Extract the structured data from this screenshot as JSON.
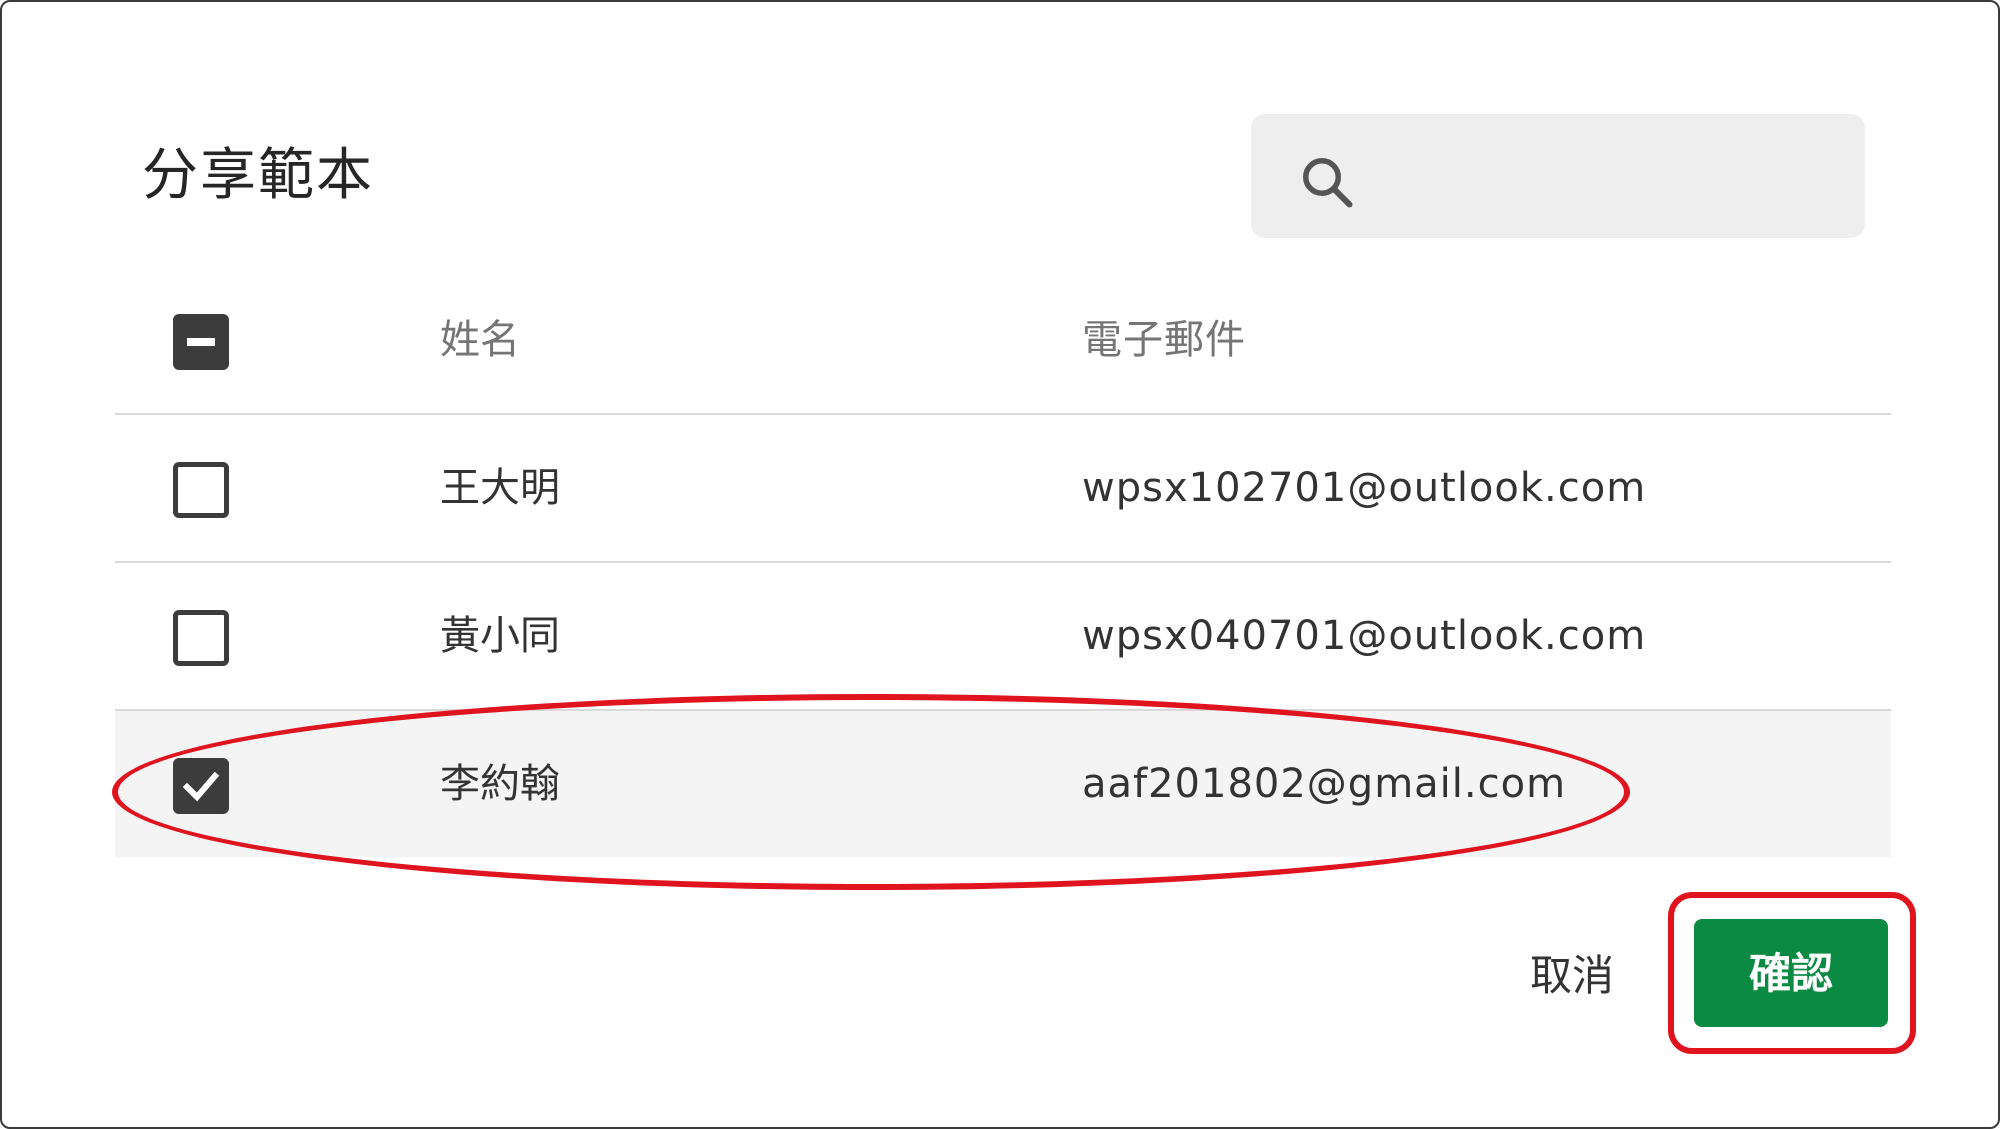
{
  "dialog": {
    "title": "分享範本",
    "search": {
      "value": "",
      "placeholder": "",
      "icon": "search-icon"
    }
  },
  "table": {
    "header": {
      "select_all_state": "indeterminate",
      "name": "姓名",
      "email": "電子郵件"
    },
    "rows": [
      {
        "name": "王大明",
        "email": "wpsx102701@outlook.com",
        "checked": false
      },
      {
        "name": "黃小同",
        "email": "wpsx040701@outlook.com",
        "checked": false
      },
      {
        "name": "李約翰",
        "email": "aaf201802@gmail.com",
        "checked": true
      }
    ]
  },
  "actions": {
    "cancel_label": "取消",
    "confirm_label": "確認"
  },
  "colors": {
    "confirm_button": "#0b8a43",
    "annotation_red": "#e0141e",
    "checkbox_dark": "#3c3c3c",
    "selected_row_bg": "#f4f4f4",
    "search_bg": "#eeeeee"
  }
}
